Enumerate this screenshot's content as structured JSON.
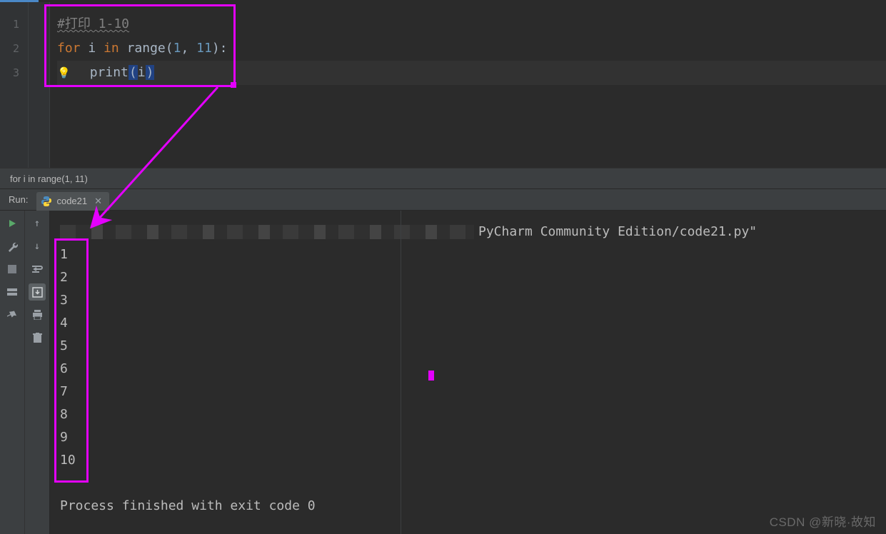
{
  "editor": {
    "gutter": [
      "1",
      "2",
      "3"
    ],
    "lines": {
      "l1_comment": "#打印 1-10",
      "l2_kw_for": "for",
      "l2_var_i": "i",
      "l2_kw_in": "in",
      "l2_fn_range": "range",
      "l2_args": "(",
      "l2_n1": "1",
      "l2_comma": ", ",
      "l2_n2": "11",
      "l2_close": "):",
      "l3_fn_print": "print",
      "l3_open": "(",
      "l3_arg": "i",
      "l3_close": ")"
    }
  },
  "breadcrumb": "for i in range(1, 11)",
  "run": {
    "label": "Run:",
    "tab_name": "code21",
    "path_suffix": "PyCharm Community Edition/code21.py\"",
    "output": [
      "1",
      "2",
      "3",
      "4",
      "5",
      "6",
      "7",
      "8",
      "9",
      "10"
    ],
    "exit_msg": "Process finished with exit code 0"
  },
  "watermark": "CSDN @新晓·故知",
  "colors": {
    "accent_magenta": "#e400ff",
    "run_green": "#59a869"
  }
}
